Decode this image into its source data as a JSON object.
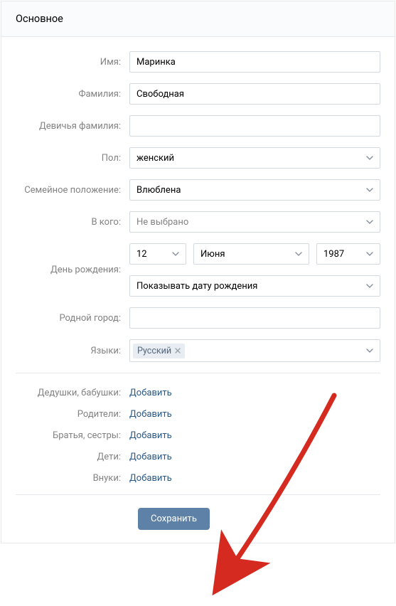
{
  "header": {
    "title": "Основное"
  },
  "fields": {
    "first_name": {
      "label": "Имя:",
      "value": "Маринка"
    },
    "last_name": {
      "label": "Фамилия:",
      "value": "Свободная"
    },
    "maiden_name": {
      "label": "Девичья фамилия:",
      "value": ""
    },
    "gender": {
      "label": "Пол:",
      "value": "женский"
    },
    "relation": {
      "label": "Семейное положение:",
      "value": "Влюблена"
    },
    "relation_partner": {
      "label": "В кого:",
      "value": "Не выбрано"
    },
    "birthday": {
      "label": "День рождения:",
      "day": "12",
      "month": "Июня",
      "year": "1987",
      "visibility": "Показывать дату рождения"
    },
    "hometown": {
      "label": "Родной город:",
      "value": ""
    },
    "languages": {
      "label": "Языки:",
      "tokens": [
        "Русский"
      ]
    }
  },
  "relatives": {
    "grandparents": {
      "label": "Дедушки, бабушки:",
      "action": "Добавить"
    },
    "parents": {
      "label": "Родители:",
      "action": "Добавить"
    },
    "siblings": {
      "label": "Братья, сестры:",
      "action": "Добавить"
    },
    "children": {
      "label": "Дети:",
      "action": "Добавить"
    },
    "grandchildren": {
      "label": "Внуки:",
      "action": "Добавить"
    }
  },
  "actions": {
    "save": "Сохранить"
  }
}
